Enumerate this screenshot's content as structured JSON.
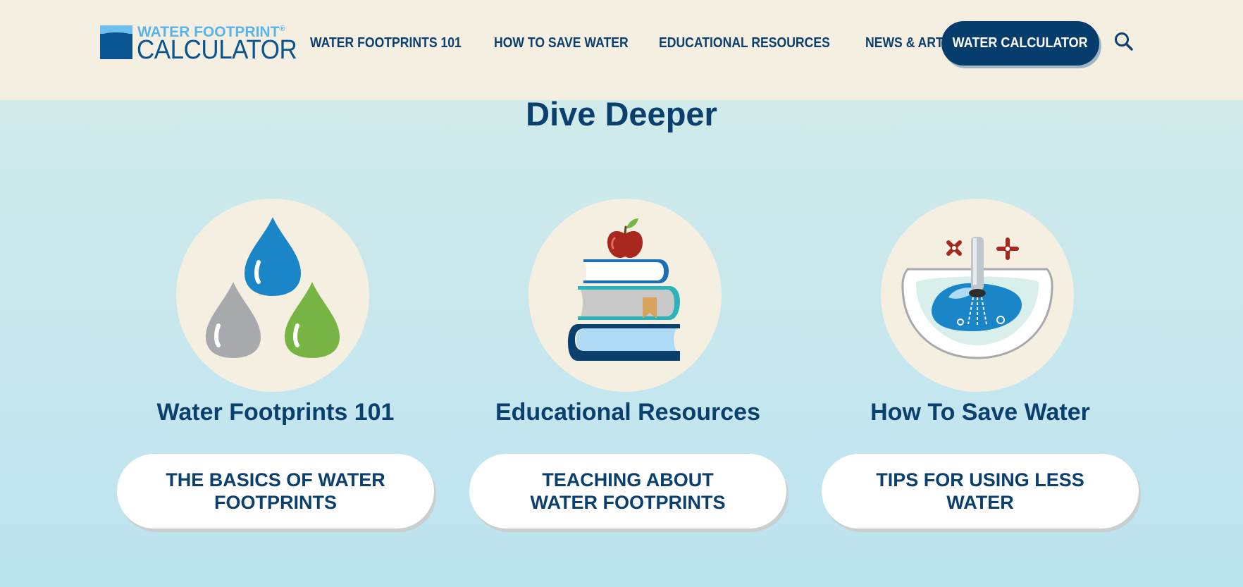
{
  "header": {
    "logo": {
      "top_text": "WATER FOOTPRINT",
      "registered": "®",
      "bottom_text": "CALCULATOR"
    },
    "nav": [
      {
        "label": "WATER FOOTPRINTS 101"
      },
      {
        "label": "HOW TO SAVE WATER"
      },
      {
        "label": "EDUCATIONAL RESOURCES"
      },
      {
        "label": "NEWS & ARTICLES"
      }
    ],
    "cta_label": "WATER CALCULATOR",
    "search_icon": "search-icon"
  },
  "section": {
    "title": "Dive Deeper",
    "cards": [
      {
        "icon": "water-drops-icon",
        "title": "Water Footprints 101",
        "button": "THE BASICS OF WATER FOOTPRINTS"
      },
      {
        "icon": "books-apple-icon",
        "title": "Educational Resources",
        "button": "TEACHING ABOUT WATER FOOTPRINTS"
      },
      {
        "icon": "sink-faucet-icon",
        "title": "How To Save Water",
        "button": "TIPS FOR USING LESS WATER"
      }
    ]
  },
  "colors": {
    "navy": "#0b3f6e",
    "cta_bg": "#063d6c",
    "header_bg": "#f5efe2",
    "drop_blue": "#1a86c8",
    "drop_gray": "#a7a9ac",
    "drop_green": "#78b443",
    "apple_red": "#a8271f"
  }
}
